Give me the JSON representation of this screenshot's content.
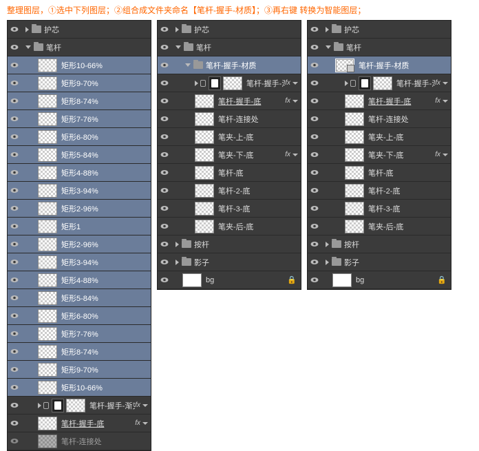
{
  "header_text": "整理图层，①选中下列图层；②组合成文件夹命名【笔杆-握手-材质】；③再右键 转换为智能图层；",
  "panel1": {
    "groups": {
      "huxin": "护芯",
      "bigan": "笔杆"
    },
    "selected_rects": [
      "矩形10-66%",
      "矩形9-70%",
      "矩形8-74%",
      "矩形7-76%",
      "矩形6-80%",
      "矩形5-84%",
      "矩形4-88%",
      "矩形3-94%",
      "矩形2-96%",
      "矩形1",
      "矩形2-96%",
      "矩形3-94%",
      "矩形4-88%",
      "矩形5-84%",
      "矩形6-80%",
      "矩形7-76%",
      "矩形8-74%",
      "矩形9-70%",
      "矩形10-66%"
    ],
    "items_after": [
      {
        "label": "笔杆-握手-渐变",
        "fx": true
      },
      {
        "label": "笔杆-握手-底",
        "underline": true,
        "fx": true
      },
      {
        "label": "笔杆-连接处"
      }
    ]
  },
  "panel2": {
    "groups": {
      "huxin": "护芯",
      "bigan": "笔杆",
      "caizhi": "笔杆-握手-材质",
      "angan": "按杆",
      "shadow": "影子"
    },
    "caizhi_items": [
      {
        "label": "笔杆-握手-渐变",
        "fx": true,
        "masked": true
      },
      {
        "label": "笔杆-握手-底",
        "underline": true,
        "fx": true
      },
      {
        "label": "笔杆-连接处"
      },
      {
        "label": "笔夹-上-底"
      },
      {
        "label": "笔夹-下-底",
        "fx": true
      },
      {
        "label": "笔杆-底"
      },
      {
        "label": "笔杆-2-底"
      },
      {
        "label": "笔杆-3-底"
      },
      {
        "label": "笔夹-后-底"
      }
    ],
    "bg": "bg"
  },
  "panel3": {
    "groups": {
      "huxin": "护芯",
      "bigan": "笔杆",
      "angan": "按杆",
      "shadow": "影子"
    },
    "smart": "笔杆-握手-材质",
    "items": [
      {
        "label": "笔杆-握手-渐变",
        "fx": true,
        "masked": true
      },
      {
        "label": "笔杆-握手-底",
        "underline": true,
        "fx": true
      },
      {
        "label": "笔杆-连接处"
      },
      {
        "label": "笔夹-上-底"
      },
      {
        "label": "笔夹-下-底",
        "fx": true
      },
      {
        "label": "笔杆-底"
      },
      {
        "label": "笔杆-2-底"
      },
      {
        "label": "笔杆-3-底"
      },
      {
        "label": "笔夹-后-底"
      }
    ],
    "bg": "bg"
  }
}
